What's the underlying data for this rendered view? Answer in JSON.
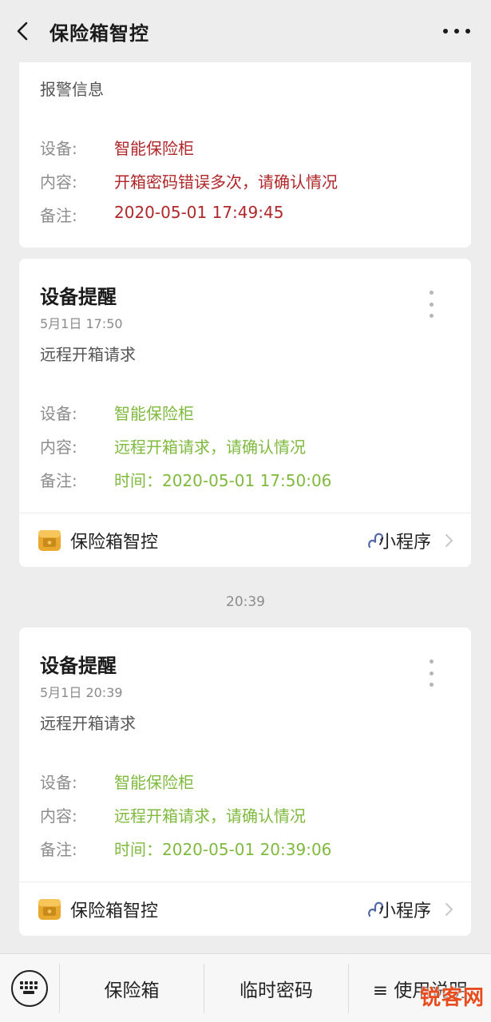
{
  "header": {
    "title": "保险箱智控"
  },
  "cards": [
    {
      "desc": "报警信息",
      "rows": [
        {
          "label": "设备:",
          "value": "智能保险柜"
        },
        {
          "label": "内容:",
          "value": "开箱密码错误多次，请确认情况"
        },
        {
          "label": "备注:",
          "value": "2020-05-01 17:49:45"
        }
      ]
    },
    {
      "title": "设备提醒",
      "time": "5月1日  17:50",
      "desc": "远程开箱请求",
      "rows": [
        {
          "label": "设备:",
          "value": "智能保险柜"
        },
        {
          "label": "内容:",
          "value": "远程开箱请求，请确认情况"
        },
        {
          "label": "备注:",
          "value": "时间：2020-05-01 17:50:06"
        }
      ],
      "footer": {
        "name": "保险箱智控",
        "link": "小程序"
      }
    },
    {
      "title": "设备提醒",
      "time": "5月1日  20:39",
      "desc": "远程开箱请求",
      "rows": [
        {
          "label": "设备:",
          "value": "智能保险柜"
        },
        {
          "label": "内容:",
          "value": "远程开箱请求，请确认情况"
        },
        {
          "label": "备注:",
          "value": "时间：2020-05-01 20:39:06"
        }
      ],
      "footer": {
        "name": "保险箱智控",
        "link": "小程序"
      }
    }
  ],
  "timestamp": "20:39",
  "bottom_menu": [
    "保险箱",
    "临时密码",
    "≡ 使用说明"
  ],
  "watermark": "锐客网",
  "colors": {
    "alert_red": "#b0272a",
    "ok_green": "#7fba3f",
    "background": "#ededed"
  },
  "icons": [
    "back-arrow-icon",
    "more-dots-icon",
    "vertical-dots-icon",
    "mini-program-logo-icon",
    "mini-program-link-icon",
    "chevron-right-icon",
    "keyboard-icon"
  ]
}
